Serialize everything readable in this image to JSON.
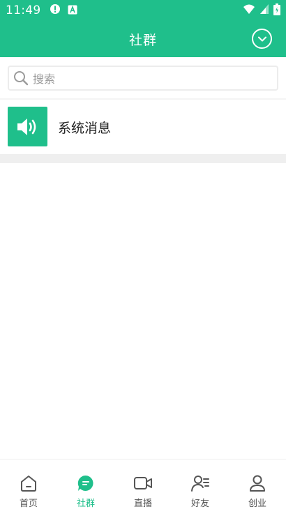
{
  "status_bar": {
    "time": "11:49",
    "left_icons": [
      "alert-circle-icon",
      "notification-app-icon"
    ],
    "right_icons": [
      "wifi-icon",
      "signal-icon",
      "battery-icon"
    ]
  },
  "header": {
    "title": "社群",
    "dropdown_icon": "chevron-down-circle-icon"
  },
  "search": {
    "placeholder": "搜索",
    "icon": "search-icon"
  },
  "list": {
    "items": [
      {
        "title": "系统消息",
        "icon": "speaker-icon"
      }
    ]
  },
  "bottom_nav": {
    "active_index": 1,
    "items": [
      {
        "label": "首页",
        "icon": "home-icon"
      },
      {
        "label": "社群",
        "icon": "chat-bubble-icon"
      },
      {
        "label": "直播",
        "icon": "video-camera-icon"
      },
      {
        "label": "好友",
        "icon": "friends-icon"
      },
      {
        "label": "创业",
        "icon": "user-icon"
      }
    ]
  },
  "colors": {
    "primary": "#1fbf8b",
    "text": "#222222",
    "muted": "#9a9a9a",
    "nav_inactive": "#555555"
  }
}
